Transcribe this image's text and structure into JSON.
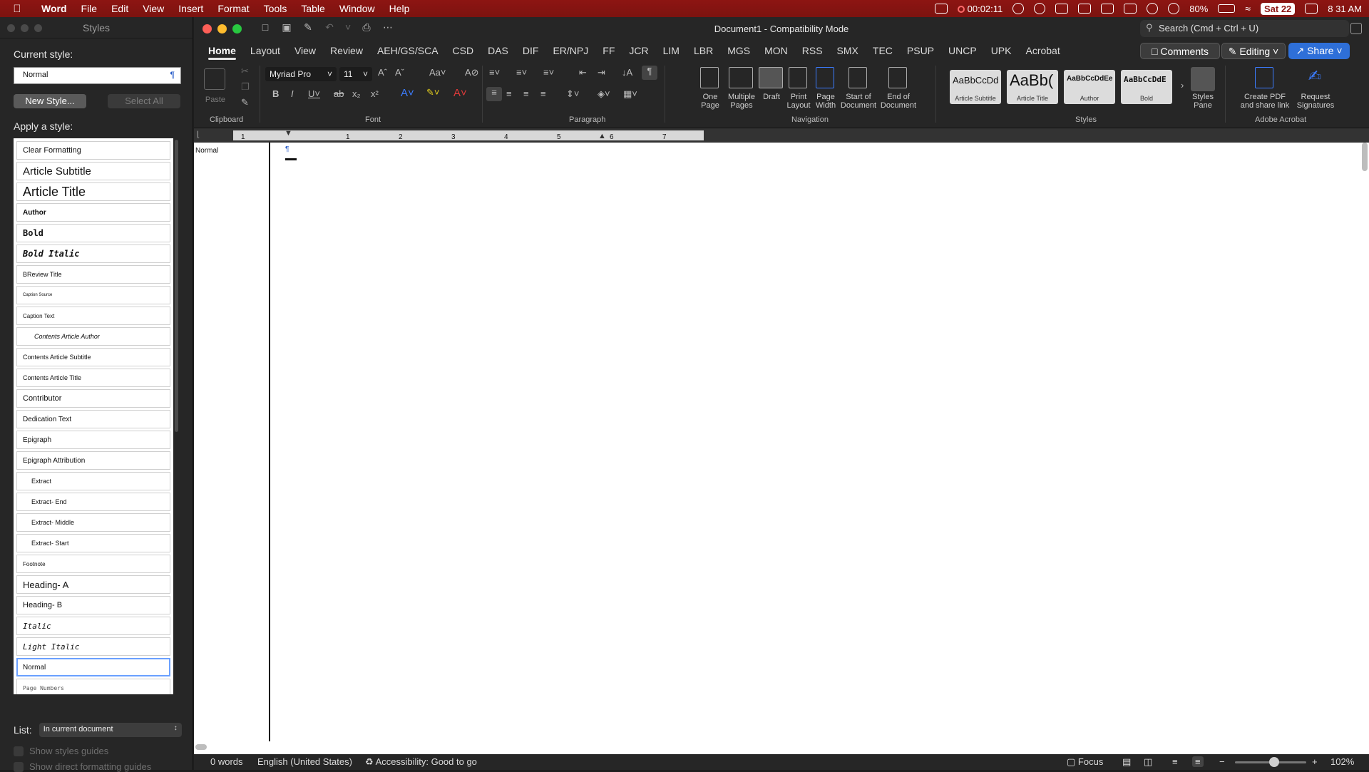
{
  "menubar": {
    "app": "Word",
    "items": [
      "File",
      "Edit",
      "View",
      "Insert",
      "Format",
      "Tools",
      "Table",
      "Window",
      "Help"
    ],
    "timer": "00:02:11",
    "battery": "80%",
    "date": "Sat 22",
    "time": "8 31 AM"
  },
  "styles_panel": {
    "title": "Styles",
    "current_style_label": "Current style:",
    "current_style_value": "Normal",
    "new_style": "New Style...",
    "select_all": "Select All",
    "apply_label": "Apply a style:",
    "styles": [
      "Clear Formatting",
      "Article Subtitle",
      "Article Title",
      "Author",
      "Bold",
      "Bold Italic",
      "BReview Title",
      "Caption Source",
      "Caption Text",
      "Contents Article Author",
      "Contents Article Subtitle",
      "Contents Article Title",
      "Contributor",
      "Dedication Text",
      "Epigraph",
      "Epigraph Attribution",
      "Extract",
      "Extract- End",
      "Extract- Middle",
      "Extract- Start",
      "Footnote",
      "Heading- A",
      "Heading- B",
      "Italic",
      "Light Italic",
      "Normal",
      "Page Numbers"
    ],
    "list_label": "List:",
    "list_value": "In current document",
    "show_styles_guides": "Show styles guides",
    "show_direct_formatting": "Show direct formatting guides"
  },
  "window": {
    "title": "Document1  -  Compatibility Mode",
    "search_placeholder": "Search (Cmd + Ctrl + U)"
  },
  "tabs": [
    "Home",
    "Layout",
    "View",
    "Review",
    "AEH/GS/SCA",
    "CSD",
    "DAS",
    "DIF",
    "ER/NPJ",
    "FF",
    "JCR",
    "LIM",
    "LBR",
    "MGS",
    "MON",
    "RSS",
    "SMX",
    "TEC",
    "PSUP",
    "UNCP",
    "UPK",
    "Acrobat"
  ],
  "toolbar_right": {
    "comments": "Comments",
    "editing": "Editing",
    "share": "Share"
  },
  "ribbon": {
    "clipboard_label": "Clipboard",
    "paste": "Paste",
    "font_label": "Font",
    "font_name": "Myriad Pro",
    "font_size": "11",
    "paragraph_label": "Paragraph",
    "navigation_label": "Navigation",
    "styles_label": "Styles",
    "acrobat_label": "Adobe Acrobat",
    "nav_buttons": [
      {
        "line1": "One",
        "line2": "Page"
      },
      {
        "line1": "Multiple",
        "line2": "Pages"
      },
      {
        "line1": "Draft",
        "line2": ""
      },
      {
        "line1": "Print",
        "line2": "Layout"
      },
      {
        "line1": "Page",
        "line2": "Width"
      },
      {
        "line1": "Start of",
        "line2": "Document"
      },
      {
        "line1": "End of",
        "line2": "Document"
      }
    ],
    "gallery": [
      {
        "preview": "AaBbCcDd",
        "name": "Article Subtitle"
      },
      {
        "preview": "AaBb(",
        "name": "Article Title"
      },
      {
        "preview": "AaBbCcDdEe",
        "name": "Author"
      },
      {
        "preview": "AaBbCcDdE",
        "name": "Bold"
      }
    ],
    "styles_pane": {
      "line1": "Styles",
      "line2": "Pane"
    },
    "create_pdf": {
      "line1": "Create PDF",
      "line2": "and share link"
    },
    "request_sig": {
      "line1": "Request",
      "line2": "Signatures"
    }
  },
  "ruler_numbers": [
    "1",
    "1",
    "2",
    "3",
    "4",
    "5",
    "6",
    "7"
  ],
  "document": {
    "style_area_label": "Normal",
    "para_mark": "¶"
  },
  "status": {
    "words": "0 words",
    "language": "English (United States)",
    "accessibility": "Accessibility: Good to go",
    "focus": "Focus",
    "zoom": "102%"
  },
  "colors": {
    "menubar": "#8d1512",
    "accent_blue": "#2e6fd8"
  }
}
